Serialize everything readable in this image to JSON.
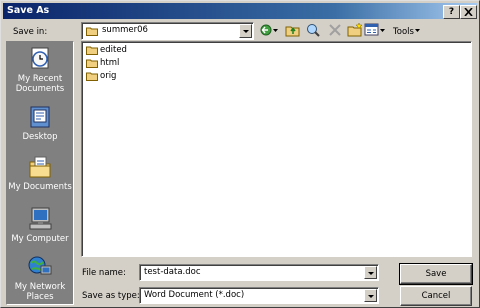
{
  "window": {
    "title": "Save As",
    "help_button": "?",
    "close_button": "X"
  },
  "toolbar": {
    "save_in_label": "Save in:",
    "save_in_value": "summer06",
    "tools_label": "Tools"
  },
  "places": [
    {
      "name": "My Recent Documents",
      "line1": "My Recent",
      "line2": "Documents",
      "icon": "recent-documents-icon"
    },
    {
      "name": "Desktop",
      "line1": "Desktop",
      "line2": "",
      "icon": "desktop-icon"
    },
    {
      "name": "My Documents",
      "line1": "My Documents",
      "line2": "",
      "icon": "my-documents-icon"
    },
    {
      "name": "My Computer",
      "line1": "My Computer",
      "line2": "",
      "icon": "my-computer-icon"
    },
    {
      "name": "My Network Places",
      "line1": "My Network",
      "line2": "Places",
      "icon": "network-places-icon"
    }
  ],
  "files": [
    {
      "name": "edited"
    },
    {
      "name": "html"
    },
    {
      "name": "orig"
    }
  ],
  "form": {
    "file_name_label": "File name:",
    "file_name_value": "test-data.doc",
    "save_as_type_label": "Save as type:",
    "save_as_type_value": "Word Document (*.doc)"
  },
  "buttons": {
    "save": "Save",
    "cancel": "Cancel"
  }
}
